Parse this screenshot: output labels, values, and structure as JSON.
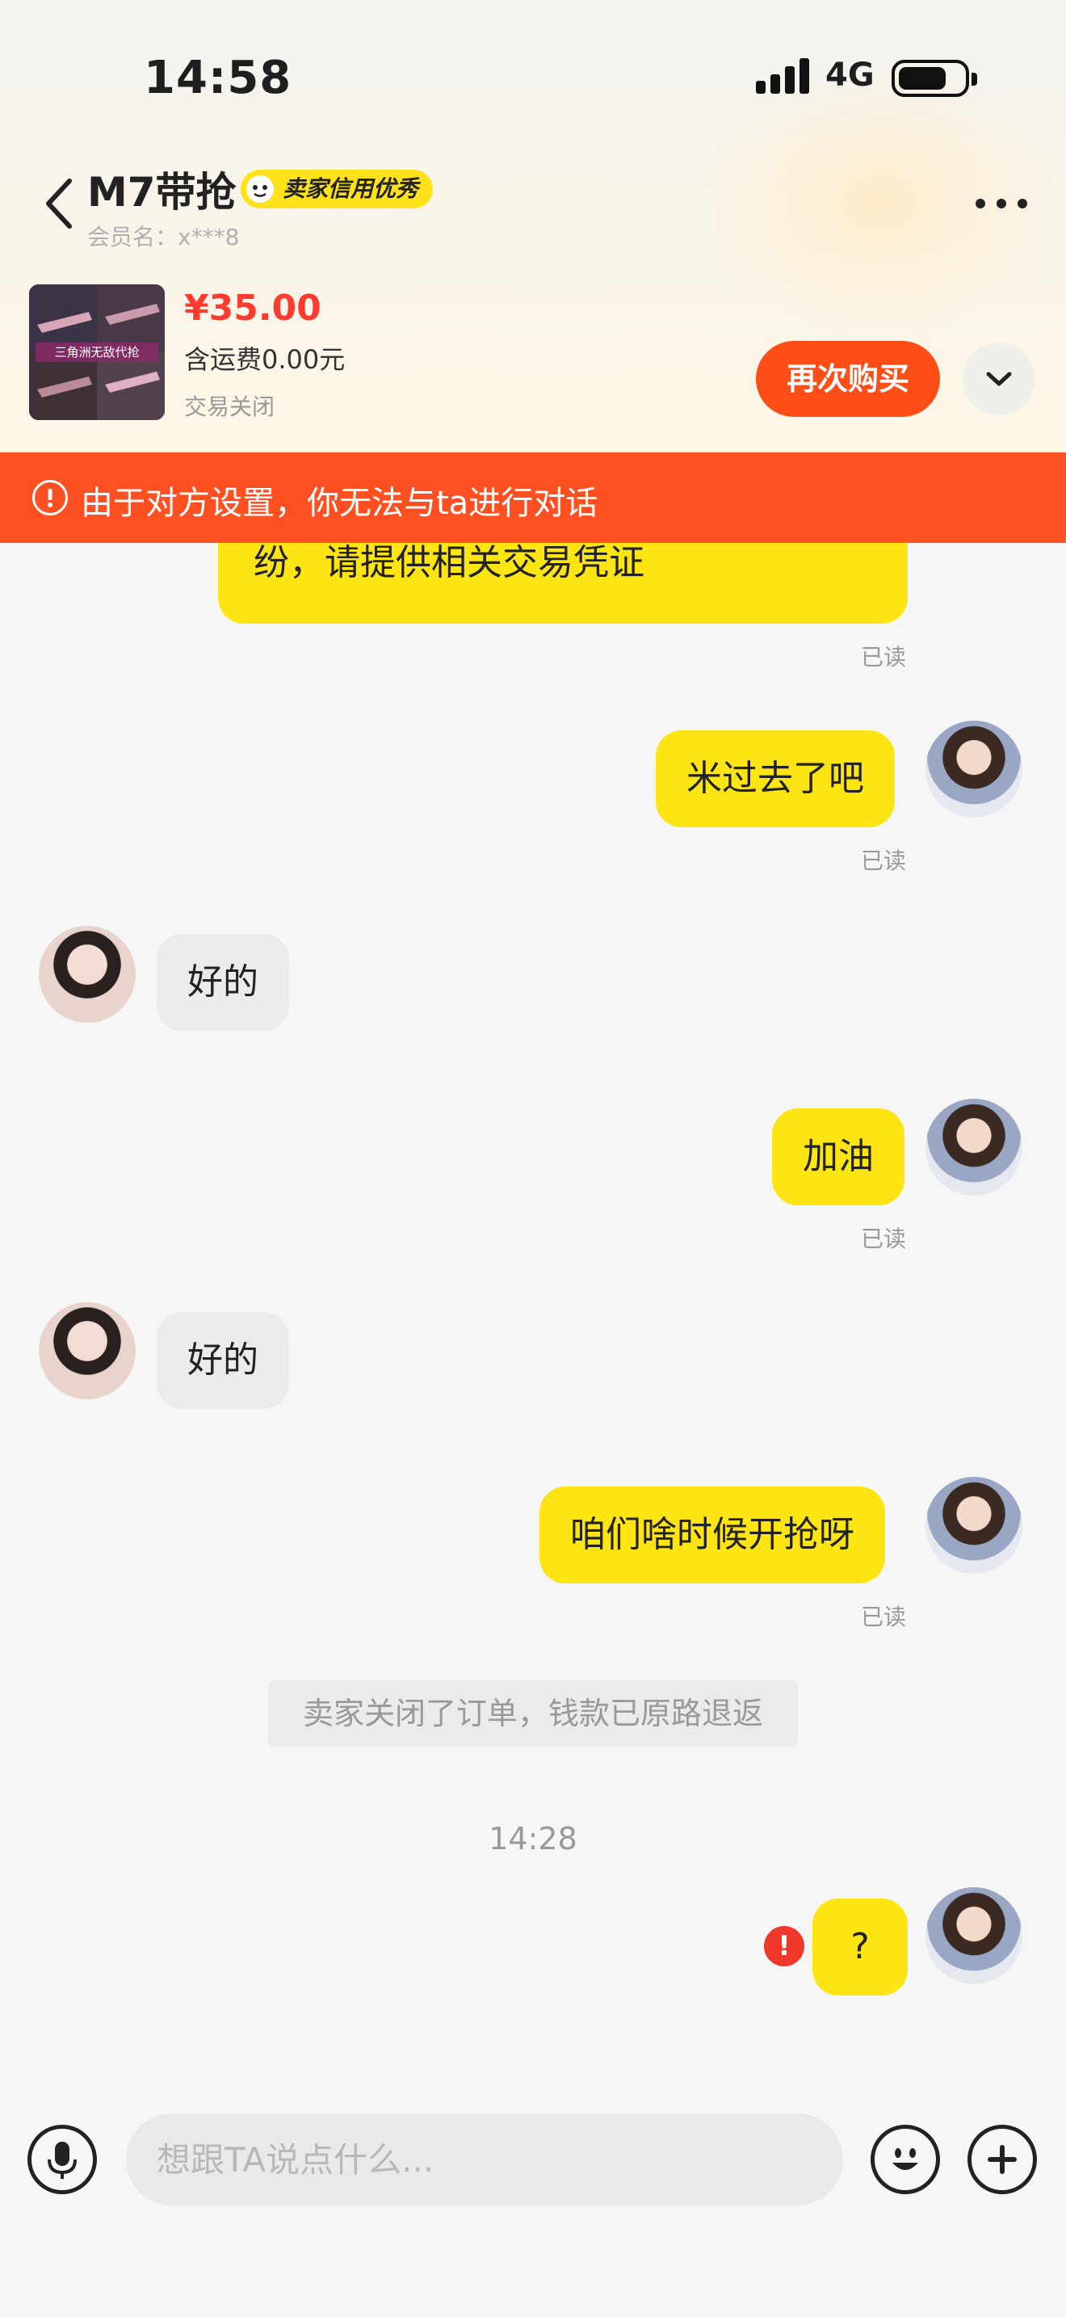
{
  "status_bar": {
    "time": "14:58",
    "network": "4G"
  },
  "header": {
    "title": "M7带抢",
    "badge": "卖家信用优秀",
    "member": "会员名：x***8"
  },
  "product": {
    "image_caption": "三角洲无敌代抢",
    "price": "¥35.00",
    "shipping": "含运费0.00元",
    "status": "交易关闭",
    "rebuy_label": "再次购买"
  },
  "banner": {
    "text": "由于对方设置，你无法与ta进行对话"
  },
  "messages": [
    {
      "from": "me",
      "text": "纷，请提供相关交易凭证",
      "read": "已读"
    },
    {
      "from": "me",
      "text": "米过去了吧",
      "read": "已读"
    },
    {
      "from": "them",
      "text": "好的"
    },
    {
      "from": "me",
      "text": "加油",
      "read": "已读"
    },
    {
      "from": "them",
      "text": "好的"
    },
    {
      "from": "me",
      "text": "咱们啥时候开抢呀",
      "read": "已读"
    },
    {
      "from": "system",
      "text": "卖家关闭了订单，钱款已原路退返"
    },
    {
      "from": "time",
      "text": "14:28"
    },
    {
      "from": "me",
      "text": "?",
      "failed": true
    }
  ],
  "input": {
    "placeholder": "想跟TA说点什么..."
  },
  "colors": {
    "accent": "#ff5021",
    "bubble_me": "#fde513",
    "price": "#ff3b30"
  }
}
